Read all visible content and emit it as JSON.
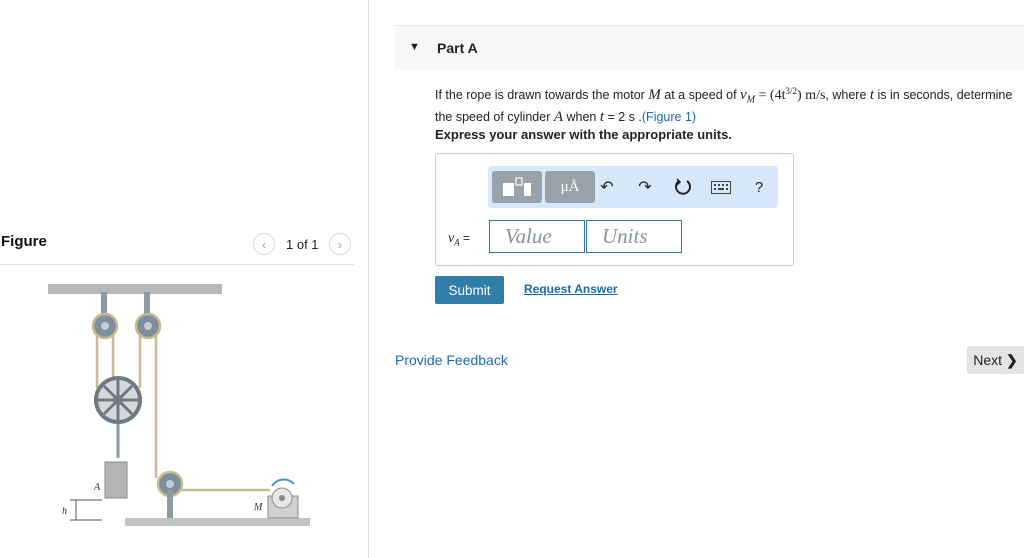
{
  "figure_panel": {
    "title": "Figure",
    "counter": "1 of 1",
    "prev_icon": "chevron-left-icon",
    "next_icon": "chevron-right-icon",
    "diagram_labels": {
      "cylinder": "A",
      "motor": "M",
      "height": "h"
    }
  },
  "part": {
    "title": "Part A",
    "caret_icon": "caret-down-icon"
  },
  "question": {
    "text_1": "If the rope is drawn towards the motor ",
    "sym_M": "M",
    "text_2": " at a speed of ",
    "sym_vM": "v",
    "sub_M": "M",
    "eq": " = (4t",
    "exp": "3/2",
    "eq_end": ") m/s",
    "text_3": ", where ",
    "sym_t": "t",
    "text_4": " is in seconds, determine the speed of cylinder ",
    "sym_A": "A",
    "text_5": " when ",
    "sym_t2": "t",
    "text_6": " = 2 s .",
    "figure_link": "(Figure 1)",
    "instruction": "Express your answer with the appropriate units."
  },
  "answer": {
    "label_sym": "v",
    "label_sub": "A",
    "label_eq": " =",
    "value_placeholder": "Value",
    "units_placeholder": "Units",
    "toolbar": {
      "units_label": "μÅ",
      "help_label": "?"
    }
  },
  "actions": {
    "submit": "Submit",
    "request_answer": "Request Answer",
    "provide_feedback": "Provide Feedback",
    "next": "Next"
  },
  "colors": {
    "accent": "#2e7ea8",
    "link": "#1a6ab3",
    "toolbar_bg": "#d6e8f9",
    "field_border": "#2f6fb4"
  }
}
